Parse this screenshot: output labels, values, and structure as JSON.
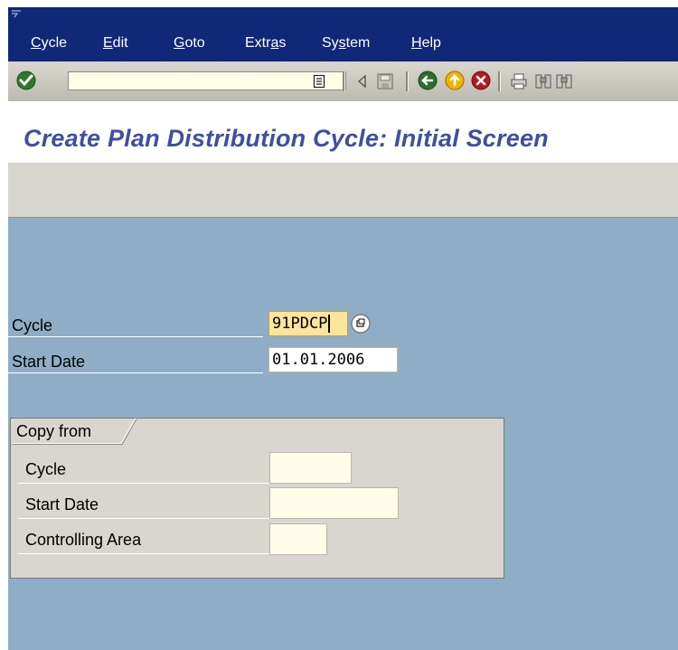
{
  "menubar": {
    "items": [
      {
        "pre": "",
        "ul": "C",
        "post": "ycle"
      },
      {
        "pre": "",
        "ul": "E",
        "post": "dit"
      },
      {
        "pre": "",
        "ul": "G",
        "post": "oto"
      },
      {
        "pre": "Extr",
        "ul": "a",
        "post": "s"
      },
      {
        "pre": "Sy",
        "ul": "s",
        "post": "tem"
      },
      {
        "pre": "",
        "ul": "H",
        "post": "elp"
      }
    ]
  },
  "toolbar": {
    "command_value": "",
    "icons": [
      "enter-icon",
      "command-history-icon",
      "back-arrow-icon",
      "save-icon",
      "back-icon",
      "exit-icon",
      "cancel-icon",
      "print-icon",
      "find-icon",
      "find-next-icon"
    ]
  },
  "header": {
    "title": "Create Plan Distribution Cycle: Initial Screen"
  },
  "form": {
    "cycle_label": "Cycle",
    "cycle_value": "91PDCP",
    "start_date_label": "Start Date",
    "start_date_value": "01.01.2006"
  },
  "copy_from": {
    "title": "Copy from",
    "cycle_label": "Cycle",
    "cycle_value": "",
    "start_date_label": "Start Date",
    "start_date_value": "",
    "controlling_area_label": "Controlling Area",
    "controlling_area_value": ""
  },
  "colors": {
    "menubar": "#102878",
    "title": "#3f4fa0",
    "canvas": "#8faec5",
    "panel": "#d8d6ce",
    "highlight_field": "#fce49a"
  }
}
